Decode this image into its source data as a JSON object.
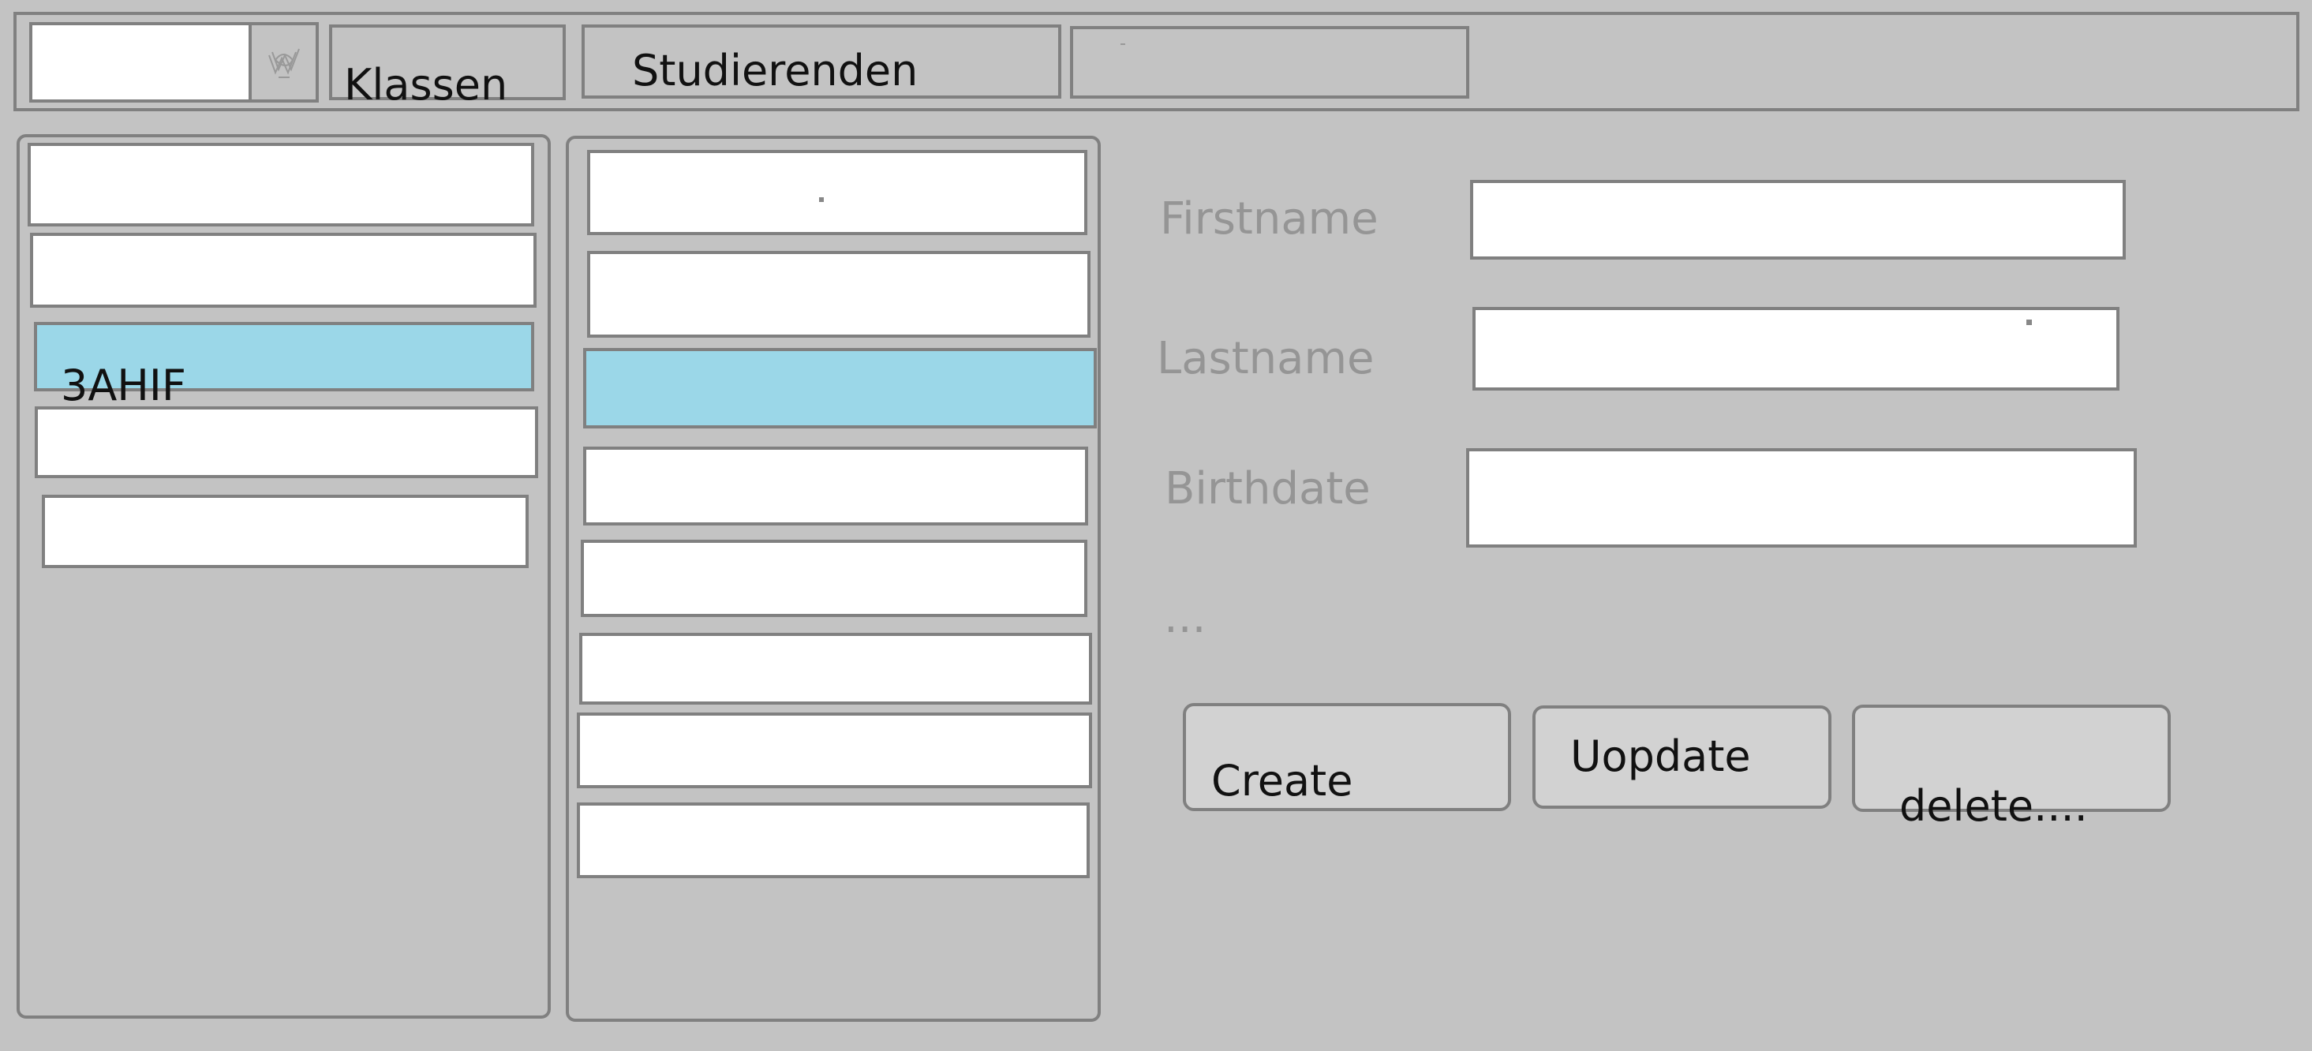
{
  "toolbar": {
    "combo_value": "",
    "klassen_label": "Klassen",
    "studierenden_label": "Studierenden",
    "search_value": "",
    "dropdown_icon": "dropdown-icon"
  },
  "classes_list": {
    "items": [
      "",
      "",
      "3AHIF",
      "",
      ""
    ],
    "selected_index": 2
  },
  "students_list": {
    "items": [
      "",
      "",
      "",
      "",
      "",
      "",
      "",
      ""
    ],
    "selected_index": 2
  },
  "form": {
    "firstname_label": "Firstname",
    "lastname_label": "Lastname",
    "birthdate_label": "Birthdate",
    "more_label": "...",
    "firstname_value": "",
    "lastname_value": "",
    "birthdate_value": ""
  },
  "actions": {
    "create_label": "Create",
    "update_label": "Uopdate",
    "delete_label": "delete...."
  },
  "colors": {
    "background": "#c3c3c3",
    "border": "#808080",
    "selected": "#9bd7e8",
    "button": "#d2d2d2",
    "label": "#959595"
  }
}
